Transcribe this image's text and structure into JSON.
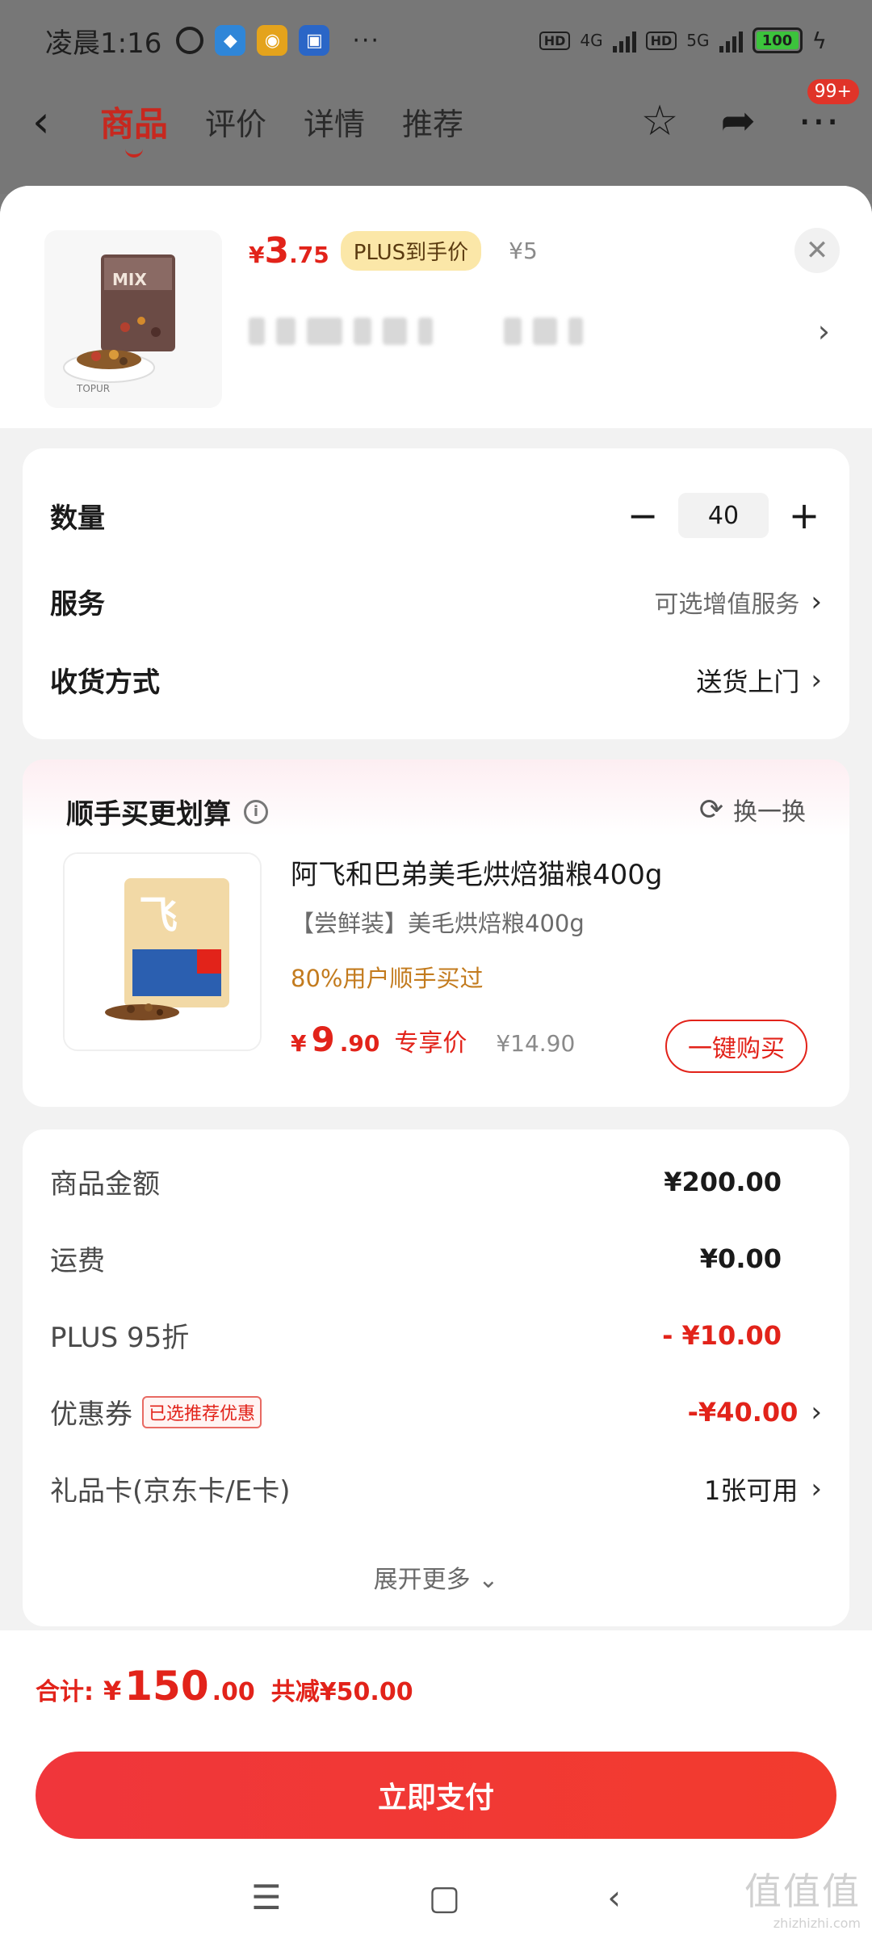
{
  "status_bar": {
    "time": "凌晨1:16",
    "more": "···",
    "net1": "4G",
    "net2": "5G",
    "hd": "HD",
    "battery": "100"
  },
  "nav": {
    "tabs": [
      {
        "label": "商品"
      },
      {
        "label": "评价"
      },
      {
        "label": "详情"
      },
      {
        "label": "推荐"
      }
    ],
    "badge": "99+"
  },
  "product": {
    "price_yen": "¥",
    "price_int": "3",
    "price_dec": ".75",
    "plus_tag": "PLUS到手价",
    "orig_price": "¥5",
    "image_brand": "MIX",
    "image_bowl": "TOPUR"
  },
  "quantity": {
    "label": "数量",
    "value": "40",
    "minus": "−",
    "plus": "+"
  },
  "service": {
    "label": "服务",
    "value": "可选增值服务"
  },
  "delivery": {
    "label": "收货方式",
    "value": "送货上门"
  },
  "bundle": {
    "title": "顺手买更划算",
    "swap": "换一换",
    "name": "阿飞和巴弟美毛烘焙猫粮400g",
    "subtitle": "【尝鲜装】美毛烘焙粮400g",
    "bought": "80%用户顺手买过",
    "price_yen": "¥",
    "price_int": "9",
    "price_dec": ".90",
    "price_label": "专享价",
    "orig_price": "¥14.90",
    "buy_label": "一键购买",
    "image_glyph": "飞"
  },
  "summary": {
    "rows": [
      {
        "label": "商品金额",
        "value": "¥200.00"
      },
      {
        "label": "运费",
        "value": "¥0.00"
      },
      {
        "label": "PLUS 95折",
        "value": "- ¥10.00"
      },
      {
        "label": "优惠券",
        "tag": "已选推荐优惠",
        "value": "-¥40.00"
      },
      {
        "label": "礼品卡(京东卡/E卡)",
        "value": "1张可用"
      }
    ],
    "expand": "展开更多"
  },
  "footer": {
    "total_label": "合计:",
    "total_yen": "¥",
    "total_int": "150",
    "total_dec": ".00",
    "saved": "共减¥50.00",
    "pay_label": "立即支付"
  },
  "watermark": {
    "logo": "值值值",
    "url": "zhizhizhi.com"
  },
  "colors": {
    "accent_red": "#e2231a",
    "plus_tag_bg": "#fbe7a8",
    "bought_orange": "#c37b1e"
  }
}
